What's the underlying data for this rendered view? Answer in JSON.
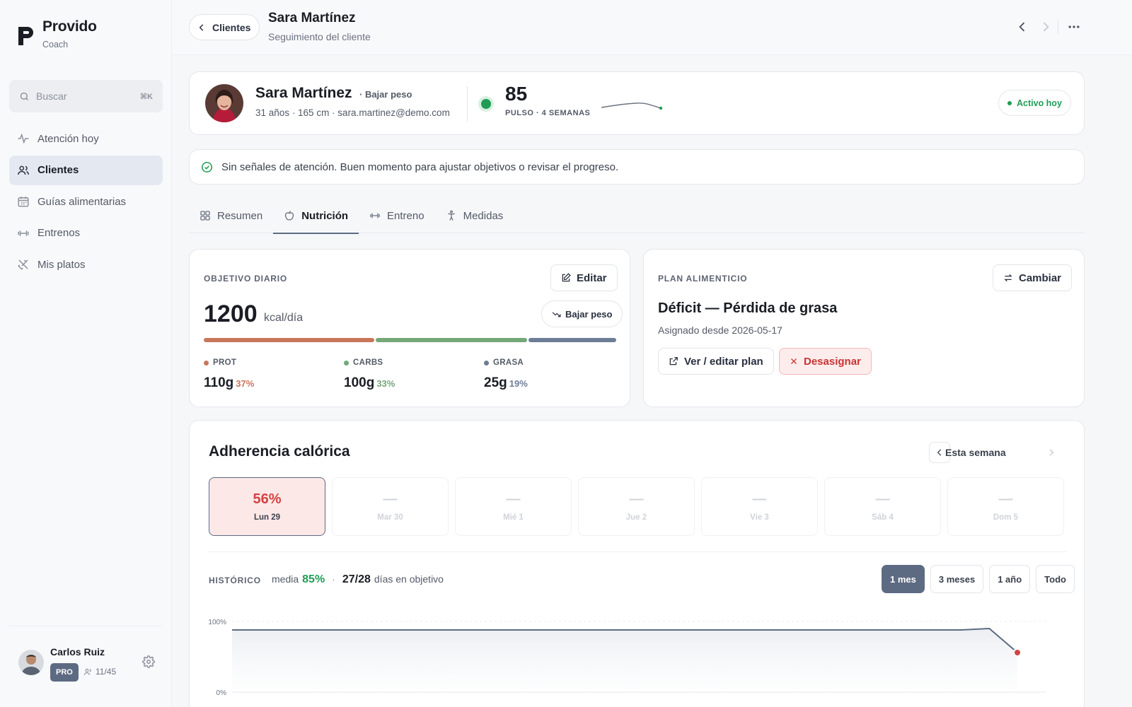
{
  "brand": {
    "name": "Provido",
    "sub": "Coach"
  },
  "search": {
    "placeholder": "Buscar",
    "shortcut": "⌘K"
  },
  "nav": [
    {
      "label": "Atención hoy",
      "icon": "pulse-icon"
    },
    {
      "label": "Clientes",
      "icon": "users-icon",
      "active": true
    },
    {
      "label": "Guías alimentarias",
      "icon": "calendar-icon"
    },
    {
      "label": "Entrenos",
      "icon": "dumbbell-icon"
    },
    {
      "label": "Mis platos",
      "icon": "utensils-icon"
    }
  ],
  "user": {
    "name": "Carlos Ruiz",
    "plan": "PRO",
    "seats": "11/45"
  },
  "header": {
    "back_label": "Clientes",
    "title": "Sara Martínez",
    "subtitle": "Seguimiento del cliente"
  },
  "client": {
    "name": "Sara Martínez",
    "goal": "· Bajar peso",
    "meta": "31 años · 165 cm · sara.martinez@demo.com",
    "pulse_value": "85",
    "pulse_label": "PULSO · 4 SEMANAS",
    "status": "Activo hoy"
  },
  "alert": {
    "text": "Sin señales de atención. Buen momento para ajustar objetivos o revisar el progreso."
  },
  "tabs": [
    {
      "label": "Resumen",
      "icon": "grid-icon"
    },
    {
      "label": "Nutrición",
      "icon": "apple-icon",
      "active": true
    },
    {
      "label": "Entreno",
      "icon": "dumbbell-icon"
    },
    {
      "label": "Medidas",
      "icon": "body-icon"
    }
  ],
  "objective": {
    "section_label": "OBJETIVO DIARIO",
    "edit_label": "Editar",
    "kcal": "1200",
    "kcal_unit": "kcal/día",
    "goal_pill": "Bajar peso",
    "macros": [
      {
        "name": "PROT",
        "grams": "110g",
        "pct": "37%",
        "share": 37,
        "color": "#c9765a"
      },
      {
        "name": "CARBS",
        "grams": "100g",
        "pct": "33%",
        "share": 33,
        "color": "#74a878"
      },
      {
        "name": "GRASA",
        "grams": "25g",
        "pct": "19%",
        "share": 19,
        "color": "#6d7d97"
      }
    ]
  },
  "plan": {
    "section_label": "PLAN ALIMENTICIO",
    "change_label": "Cambiar",
    "title": "Déficit — Pérdida de grasa",
    "since": "Asignado desde 2026-05-17",
    "view_label": "Ver / editar plan",
    "unassign_label": "Desasignar"
  },
  "adherence": {
    "title": "Adherencia calórica",
    "week_label": "Esta semana",
    "days": [
      {
        "value": "56%",
        "label": "Lun 29",
        "today": true
      },
      {
        "value": "—",
        "label": "Mar 30"
      },
      {
        "value": "—",
        "label": "Mié 1"
      },
      {
        "value": "—",
        "label": "Jue 2"
      },
      {
        "value": "—",
        "label": "Vie 3"
      },
      {
        "value": "—",
        "label": "Sáb 4"
      },
      {
        "value": "—",
        "label": "Dom 5"
      }
    ],
    "history_label": "HISTÓRICO",
    "avg_prefix": "media",
    "avg_value": "85%",
    "days_on_target": "27/28",
    "days_suffix": "días en objetivo",
    "ranges": [
      {
        "label": "1 mes",
        "active": true
      },
      {
        "label": "3 meses"
      },
      {
        "label": "1 año"
      },
      {
        "label": "Todo"
      }
    ]
  },
  "chart_data": {
    "type": "area",
    "y_tick_labels": [
      "100%",
      "0%"
    ],
    "ylim": [
      0,
      100
    ],
    "values": [
      88,
      88,
      88,
      88,
      88,
      88,
      88,
      88,
      88,
      88,
      88,
      88,
      88,
      88,
      88,
      88,
      88,
      88,
      88,
      88,
      88,
      88,
      88,
      88,
      88,
      88,
      88,
      90,
      56
    ],
    "color": "#5d6b82",
    "highlight_color": "#d24343"
  }
}
